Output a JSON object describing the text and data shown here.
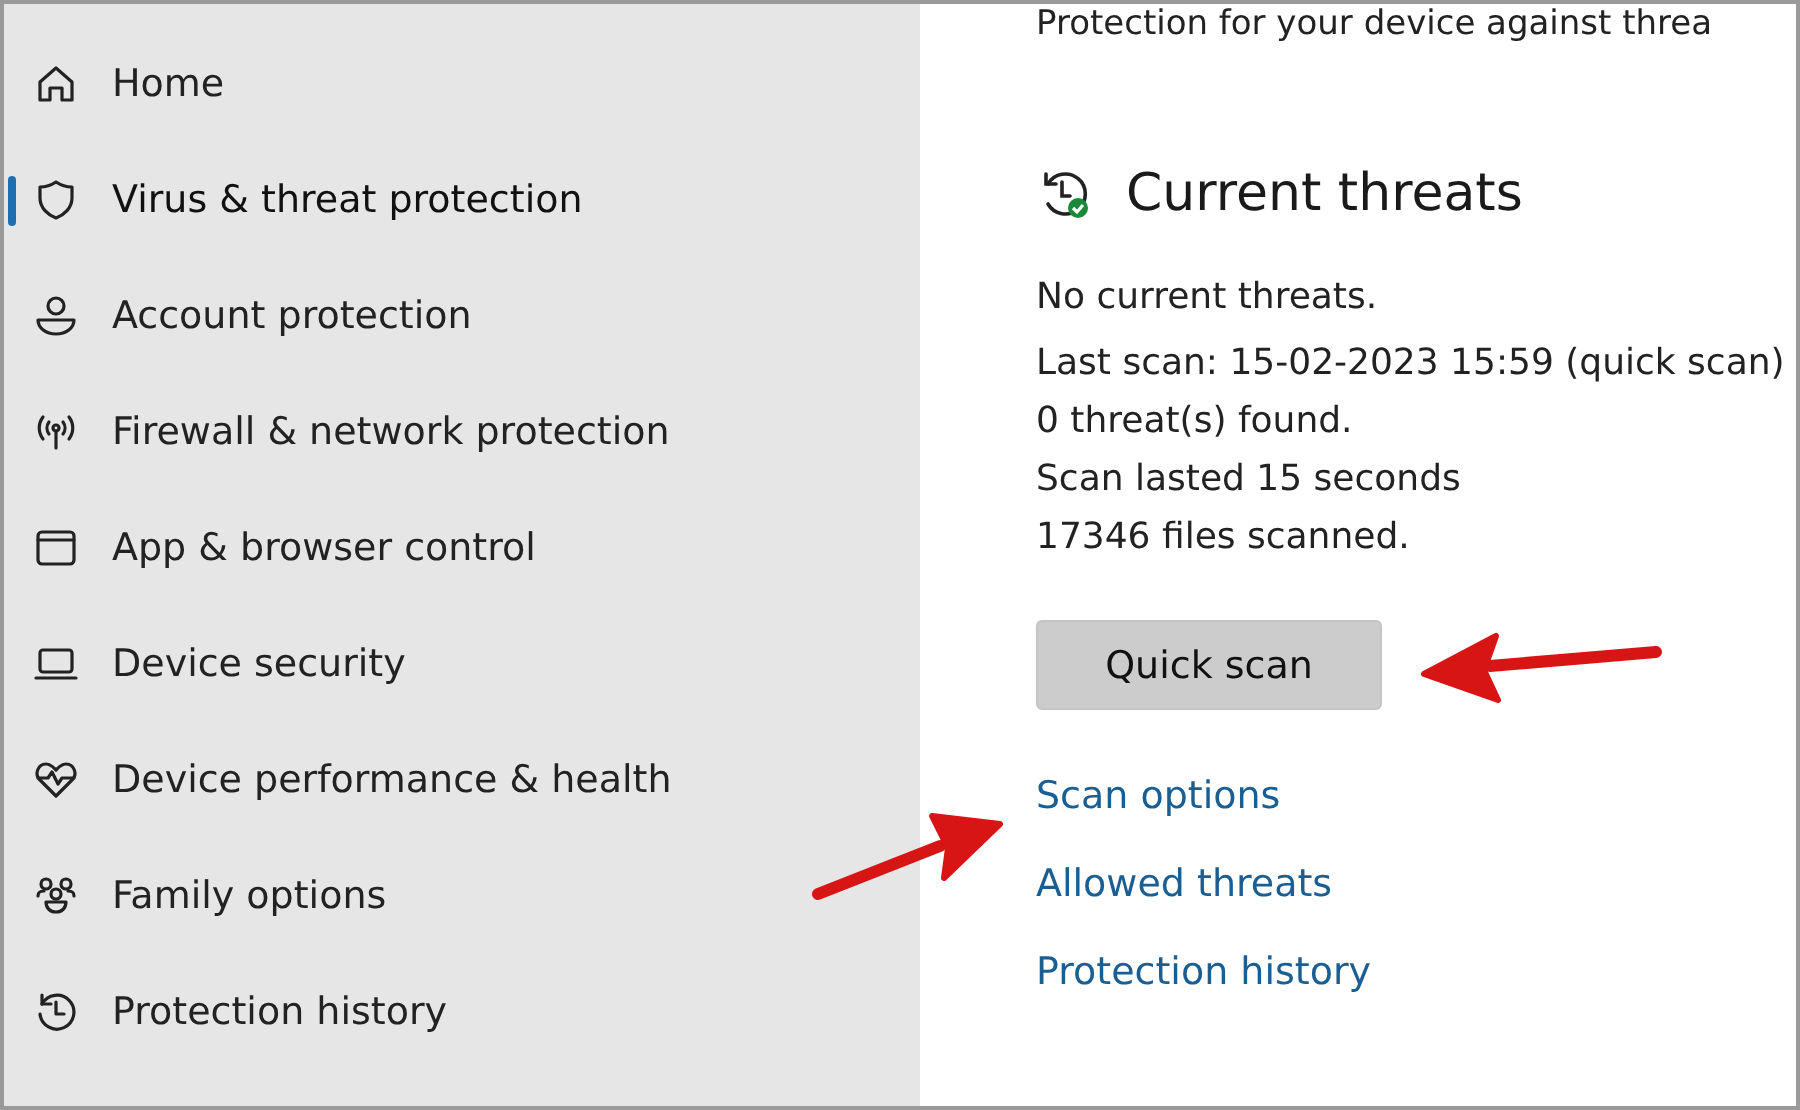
{
  "sidebar": {
    "items": [
      {
        "label": "Home",
        "selected": false
      },
      {
        "label": "Virus & threat protection",
        "selected": true
      },
      {
        "label": "Account protection",
        "selected": false
      },
      {
        "label": "Firewall & network protection",
        "selected": false
      },
      {
        "label": "App & browser control",
        "selected": false
      },
      {
        "label": "Device security",
        "selected": false
      },
      {
        "label": "Device performance & health",
        "selected": false
      },
      {
        "label": "Family options",
        "selected": false
      },
      {
        "label": "Protection history",
        "selected": false
      }
    ]
  },
  "main": {
    "cut_text": "Protection for your device against threa",
    "section_title": "Current threats",
    "status_lines": [
      "No current threats.",
      "Last scan: 15-02-2023 15:59 (quick scan)",
      "0 threat(s) found.",
      "Scan lasted 15 seconds",
      "17346 files scanned."
    ],
    "button": "Quick scan",
    "links": [
      "Scan options",
      "Allowed threats",
      "Protection history"
    ]
  }
}
